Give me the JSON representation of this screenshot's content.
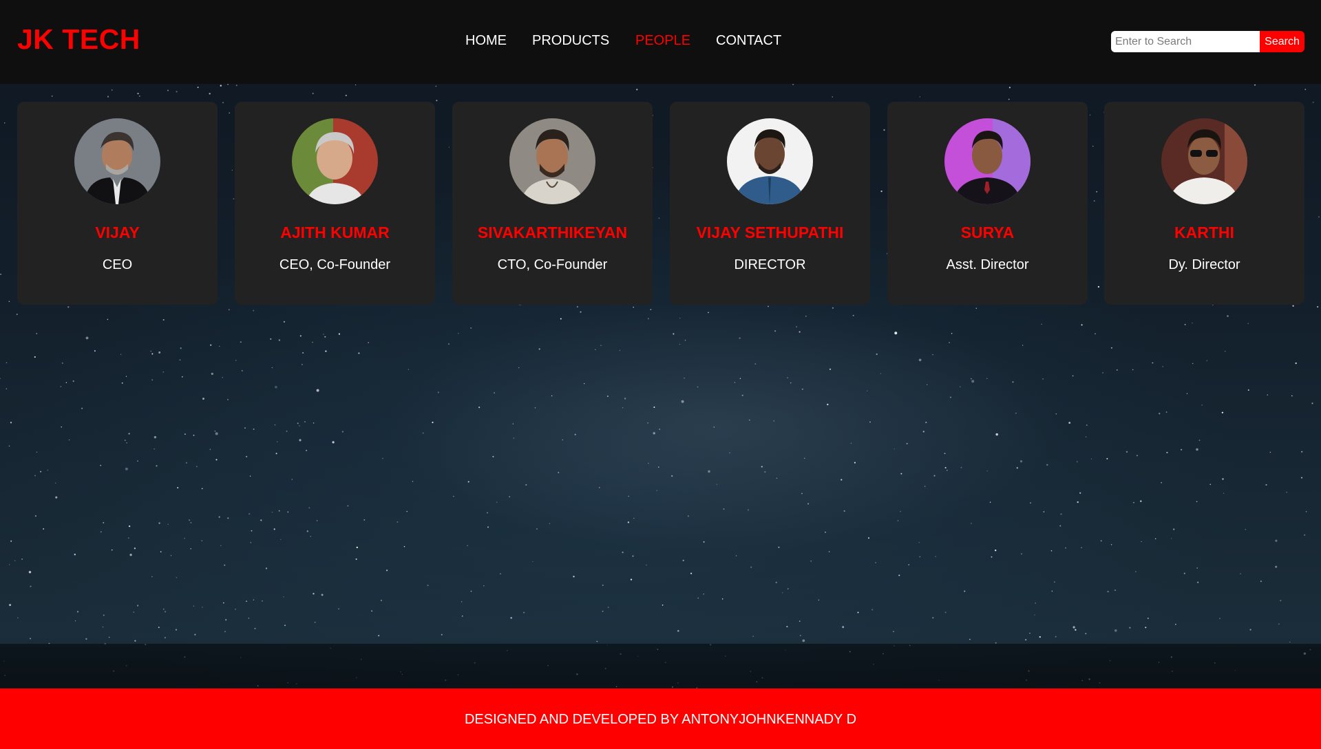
{
  "brand": {
    "logo_text": "JK TECH",
    "accent_color": "#ff0000"
  },
  "nav": {
    "items": [
      {
        "label": "HOME",
        "active": false
      },
      {
        "label": "PRODUCTS",
        "active": false
      },
      {
        "label": "PEOPLE",
        "active": true
      },
      {
        "label": "CONTACT",
        "active": false
      }
    ]
  },
  "search": {
    "placeholder": "Enter to Search",
    "button_label": "Search"
  },
  "people": [
    {
      "name": "VIJAY",
      "role": "CEO"
    },
    {
      "name": "AJITH KUMAR",
      "role": "CEO, Co-Founder"
    },
    {
      "name": "SIVAKARTHIKEYAN",
      "role": "CTO, Co-Founder"
    },
    {
      "name": "VIJAY SETHUPATHI",
      "role": "DIRECTOR"
    },
    {
      "name": "SURYA",
      "role": "Asst. Director"
    },
    {
      "name": "KARTHI",
      "role": "Dy. Director"
    }
  ],
  "footer": {
    "text": "DESIGNED AND DEVELOPED BY ANTONYJOHNKENNADY D"
  }
}
